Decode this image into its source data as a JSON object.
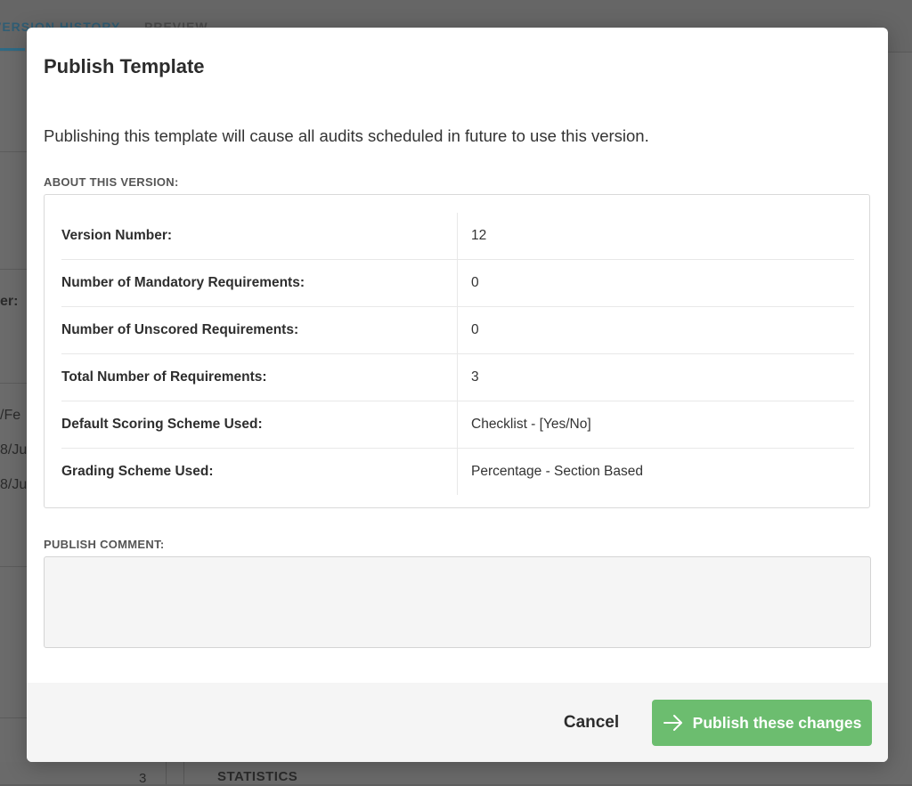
{
  "background": {
    "tabs": [
      "VERSION HISTORY",
      "PREVIEW"
    ],
    "side_text": [
      "er:",
      "/Fe",
      "8/Ju",
      "8/Ju"
    ],
    "bottom_heading": "STATISTICS",
    "bottom_number": "3"
  },
  "modal": {
    "title": "Publish Template",
    "description": "Publishing this template will cause all audits scheduled in future to use this version.",
    "about_label": "ABOUT THIS VERSION:",
    "rows": [
      {
        "label": "Version Number:",
        "value": "12"
      },
      {
        "label": "Number of Mandatory Requirements:",
        "value": "0"
      },
      {
        "label": "Number of Unscored Requirements:",
        "value": "0"
      },
      {
        "label": "Total Number of Requirements:",
        "value": "3"
      },
      {
        "label": "Default Scoring Scheme Used:",
        "value": "Checklist - [Yes/No]"
      },
      {
        "label": "Grading Scheme Used:",
        "value": "Percentage - Section Based"
      }
    ],
    "comment_label": "PUBLISH COMMENT:",
    "comment_value": "",
    "cancel_label": "Cancel",
    "publish_label": "Publish these changes",
    "publish_icon": "arrow-right-icon"
  },
  "colors": {
    "primary_button": "#6cbd6f",
    "overlay": "#6a6a6a",
    "footer": "#f5f5f5",
    "accent_tab": "#2f5d74"
  }
}
